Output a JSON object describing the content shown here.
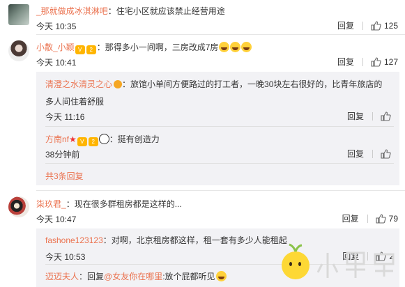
{
  "comments": [
    {
      "user": "_那就做成冰淇淋吧",
      "text": "：住宅小区就应该禁止经营用途",
      "time": "今天 10:35",
      "reply_label": "回复",
      "likes": "125"
    },
    {
      "user": "小散_小颖",
      "text": "：那得多小一间啊，三房改成7房",
      "time": "今天 10:41",
      "reply_label": "回复",
      "likes": "127",
      "sub_replies": [
        {
          "user": "清澄之水清灵之心",
          "text": "：旅馆小单间方便路过的打工者，一晚30块左右很好的，比青年旅店的",
          "text2": "多人间住着舒服",
          "time": "今天 11:16",
          "reply_label": "回复",
          "likes": ""
        },
        {
          "user": "方南nf",
          "text": "：挺有创造力",
          "time": "38分钟前",
          "reply_label": "回复",
          "likes": ""
        }
      ],
      "more_replies": "共3条回复"
    },
    {
      "user": "柒玖君_",
      "text": "：现在很多群租房都是这样的...",
      "time": "今天 10:47",
      "reply_label": "回复",
      "likes": "79",
      "sub_replies": [
        {
          "user": "fashone123123",
          "text": "：对啊，北京租房都这样，租一套有多少人能租起",
          "time": "今天 10:53",
          "reply_label": "回复",
          "likes": "2"
        },
        {
          "user": "迈迈夫人",
          "text_prefix": "：回复",
          "mention": "@女友你在哪里",
          "text": ":放个屁都听见"
        }
      ]
    }
  ],
  "colors": {
    "username": "#eb7350",
    "text": "#333333",
    "reply_bg": "#f2f2f5"
  },
  "icons": {
    "like": "thumbs-up-icon"
  }
}
